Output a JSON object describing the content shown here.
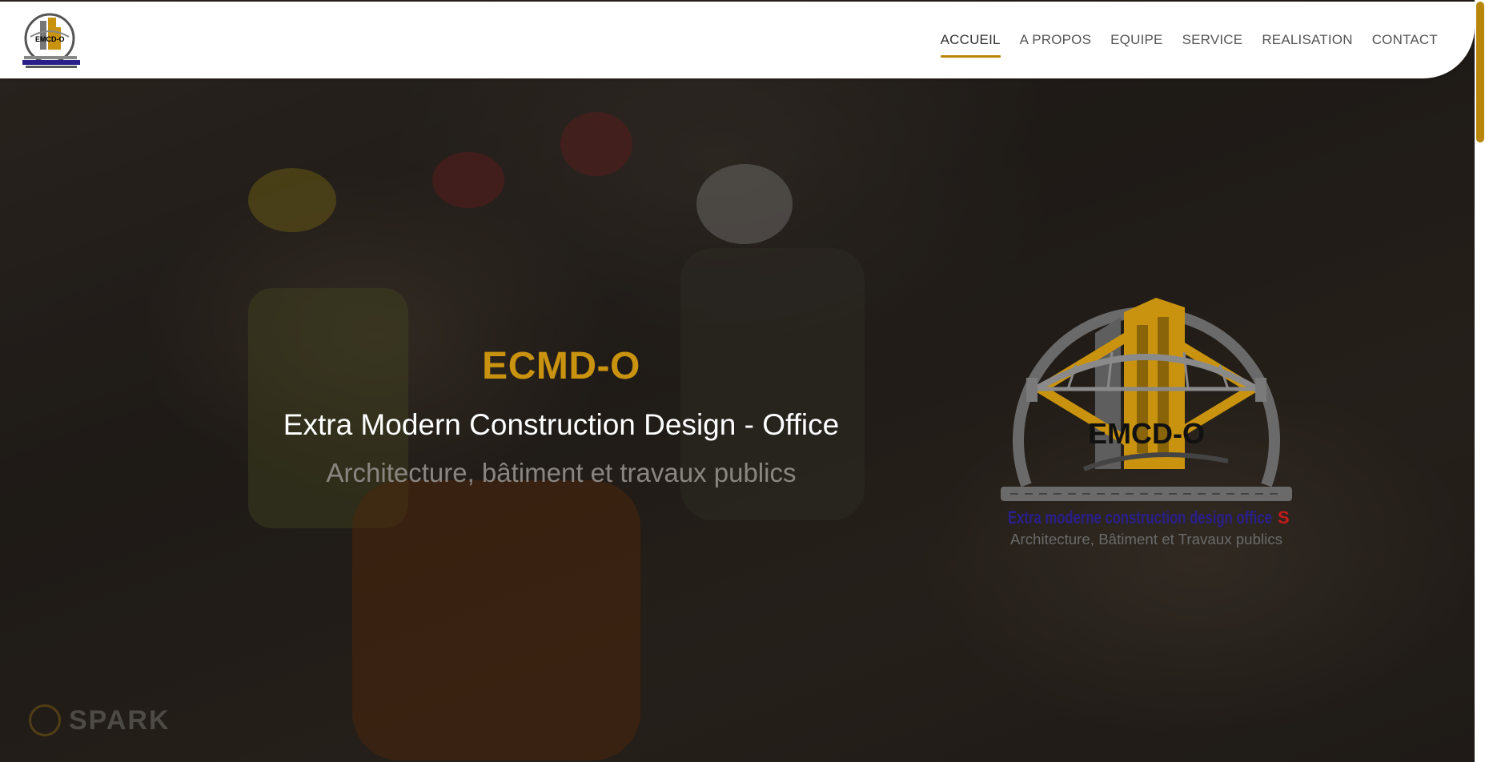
{
  "header": {
    "logo": {
      "text": "EMCD-O",
      "tagline": "Extra moderne construction design office",
      "subtagline": "Architecture, Bâtiment et Travaux publics"
    },
    "nav": [
      {
        "label": "ACCUEIL",
        "active": true
      },
      {
        "label": "A PROPOS",
        "active": false
      },
      {
        "label": "EQUIPE",
        "active": false
      },
      {
        "label": "SERVICE",
        "active": false
      },
      {
        "label": "REALISATION",
        "active": false
      },
      {
        "label": "CONTACT",
        "active": false
      }
    ]
  },
  "hero": {
    "title": "ECMD-O",
    "subtitle": "Extra Modern Construction Design - Office",
    "tagline": "Architecture, bâtiment et travaux publics",
    "emblem": {
      "name": "EMCD-O",
      "line1": "Extra moderne construction design office",
      "line1_suffix": "S",
      "line2": "Architecture, Bâtiment et Travaux publics"
    },
    "watermark": "SPARK"
  },
  "colors": {
    "accent": "#c9930f",
    "nav_text": "#555555",
    "header_bg": "#ffffff",
    "tagline": "#8a8580"
  }
}
